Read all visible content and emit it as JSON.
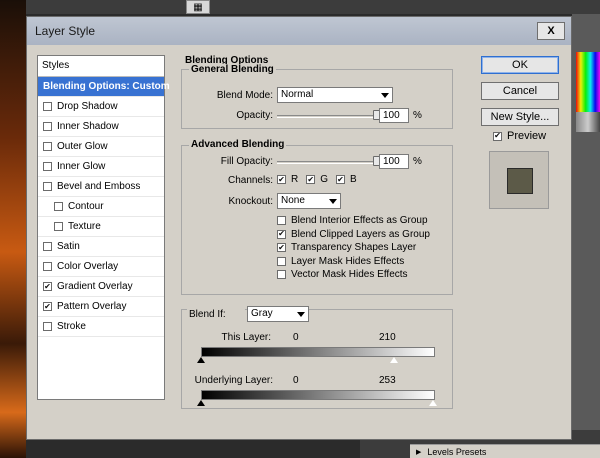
{
  "window": {
    "title": "Layer Style",
    "close_label": "X"
  },
  "styles": {
    "header": "Styles",
    "items": [
      {
        "label": "Blending Options: Custom",
        "selected": true,
        "has_checkbox": false,
        "checked": false,
        "sub": false
      },
      {
        "label": "Drop Shadow",
        "has_checkbox": true,
        "checked": false,
        "sub": false
      },
      {
        "label": "Inner Shadow",
        "has_checkbox": true,
        "checked": false,
        "sub": false
      },
      {
        "label": "Outer Glow",
        "has_checkbox": true,
        "checked": false,
        "sub": false
      },
      {
        "label": "Inner Glow",
        "has_checkbox": true,
        "checked": false,
        "sub": false
      },
      {
        "label": "Bevel and Emboss",
        "has_checkbox": true,
        "checked": false,
        "sub": false
      },
      {
        "label": "Contour",
        "has_checkbox": true,
        "checked": false,
        "sub": true
      },
      {
        "label": "Texture",
        "has_checkbox": true,
        "checked": false,
        "sub": true
      },
      {
        "label": "Satin",
        "has_checkbox": true,
        "checked": false,
        "sub": false
      },
      {
        "label": "Color Overlay",
        "has_checkbox": true,
        "checked": false,
        "sub": false
      },
      {
        "label": "Gradient Overlay",
        "has_checkbox": true,
        "checked": true,
        "sub": false
      },
      {
        "label": "Pattern Overlay",
        "has_checkbox": true,
        "checked": true,
        "sub": false
      },
      {
        "label": "Stroke",
        "has_checkbox": true,
        "checked": false,
        "sub": false
      }
    ]
  },
  "blending": {
    "section_title": "Blending Options",
    "general": {
      "title": "General Blending",
      "blend_mode_label": "Blend Mode:",
      "blend_mode_value": "Normal",
      "opacity_label": "Opacity:",
      "opacity_value": "100",
      "opacity_fraction": 1.0,
      "unit": "%"
    },
    "advanced": {
      "title": "Advanced Blending",
      "fill_opacity_label": "Fill Opacity:",
      "fill_opacity_value": "100",
      "fill_opacity_fraction": 1.0,
      "unit": "%",
      "channels_label": "Channels:",
      "channels": [
        {
          "label": "R",
          "checked": true
        },
        {
          "label": "G",
          "checked": true
        },
        {
          "label": "B",
          "checked": true
        }
      ],
      "knockout_label": "Knockout:",
      "knockout_value": "None",
      "options": [
        {
          "label": "Blend Interior Effects as Group",
          "checked": false
        },
        {
          "label": "Blend Clipped Layers as Group",
          "checked": true
        },
        {
          "label": "Transparency Shapes Layer",
          "checked": true
        },
        {
          "label": "Layer Mask Hides Effects",
          "checked": false
        },
        {
          "label": "Vector Mask Hides Effects",
          "checked": false
        }
      ]
    },
    "blend_if": {
      "label": "Blend If:",
      "value": "Gray",
      "this_layer": {
        "label": "This Layer:",
        "low": "0",
        "high": "210"
      },
      "underlying_layer": {
        "label": "Underlying Layer:",
        "low": "0",
        "high": "253"
      }
    }
  },
  "buttons": {
    "ok": "OK",
    "cancel": "Cancel",
    "new_style": "New Style...",
    "preview_label": "Preview",
    "preview_checked": true
  },
  "background": {
    "panel_label": "Levels Presets"
  },
  "colors": {
    "selection": "#3872d2",
    "dialog_bg": "#d4d0c8",
    "preview_swatch": "#5c5a48"
  }
}
